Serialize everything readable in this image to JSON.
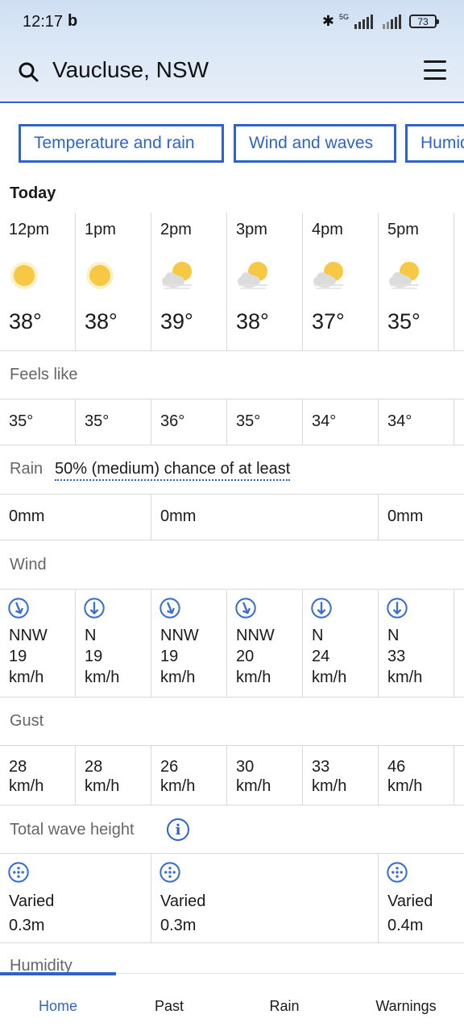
{
  "status": {
    "time": "12:17",
    "b_glyph": "b",
    "network": "5G",
    "battery": "73"
  },
  "header": {
    "location": "Vaucluse, NSW"
  },
  "tabs": [
    "Temperature and rain",
    "Wind and waves",
    "Humidity"
  ],
  "today_label": "Today",
  "hourly": [
    {
      "hour": "12pm",
      "icon": "sunny-icon",
      "temp": "38°",
      "feels": "35°"
    },
    {
      "hour": "1pm",
      "icon": "sunny-icon",
      "temp": "38°",
      "feels": "35°"
    },
    {
      "hour": "2pm",
      "icon": "partly-cloudy-icon",
      "temp": "39°",
      "feels": "36°"
    },
    {
      "hour": "3pm",
      "icon": "partly-cloudy-icon",
      "temp": "38°",
      "feels": "35°"
    },
    {
      "hour": "4pm",
      "icon": "partly-cloudy-icon",
      "temp": "37°",
      "feels": "34°"
    },
    {
      "hour": "5pm",
      "icon": "partly-cloudy-icon",
      "temp": "35°",
      "feels": "34°"
    }
  ],
  "feels_like_label": "Feels like",
  "rain": {
    "label": "Rain",
    "chance": "50% (medium) chance of at least",
    "values": [
      "0mm",
      "0mm",
      "0mm"
    ]
  },
  "wind": {
    "label": "Wind",
    "items": [
      {
        "dir": "NNW",
        "speed": "19",
        "unit": "km/h"
      },
      {
        "dir": "N",
        "speed": "19",
        "unit": "km/h"
      },
      {
        "dir": "NNW",
        "speed": "19",
        "unit": "km/h"
      },
      {
        "dir": "NNW",
        "speed": "20",
        "unit": "km/h"
      },
      {
        "dir": "N",
        "speed": "24",
        "unit": "km/h"
      },
      {
        "dir": "N",
        "speed": "33",
        "unit": "km/h"
      }
    ]
  },
  "gust": {
    "label": "Gust",
    "items": [
      {
        "speed": "28",
        "unit": "km/h"
      },
      {
        "speed": "28",
        "unit": "km/h"
      },
      {
        "speed": "26",
        "unit": "km/h"
      },
      {
        "speed": "30",
        "unit": "km/h"
      },
      {
        "speed": "33",
        "unit": "km/h"
      },
      {
        "speed": "46",
        "unit": "km/h"
      }
    ]
  },
  "waves": {
    "label": "Total wave height",
    "items": [
      {
        "dir": "Varied",
        "height": "0.3m"
      },
      {
        "dir": "Varied",
        "height": "0.3m"
      },
      {
        "dir": "Varied",
        "height": "0.4m"
      }
    ]
  },
  "humidity_label": "Humidity",
  "nav": {
    "home": "Home",
    "past": "Past",
    "rain": "Rain",
    "warnings": "Warnings"
  },
  "colors": {
    "accent": "#2f63c9",
    "sun": "#f7c843"
  }
}
